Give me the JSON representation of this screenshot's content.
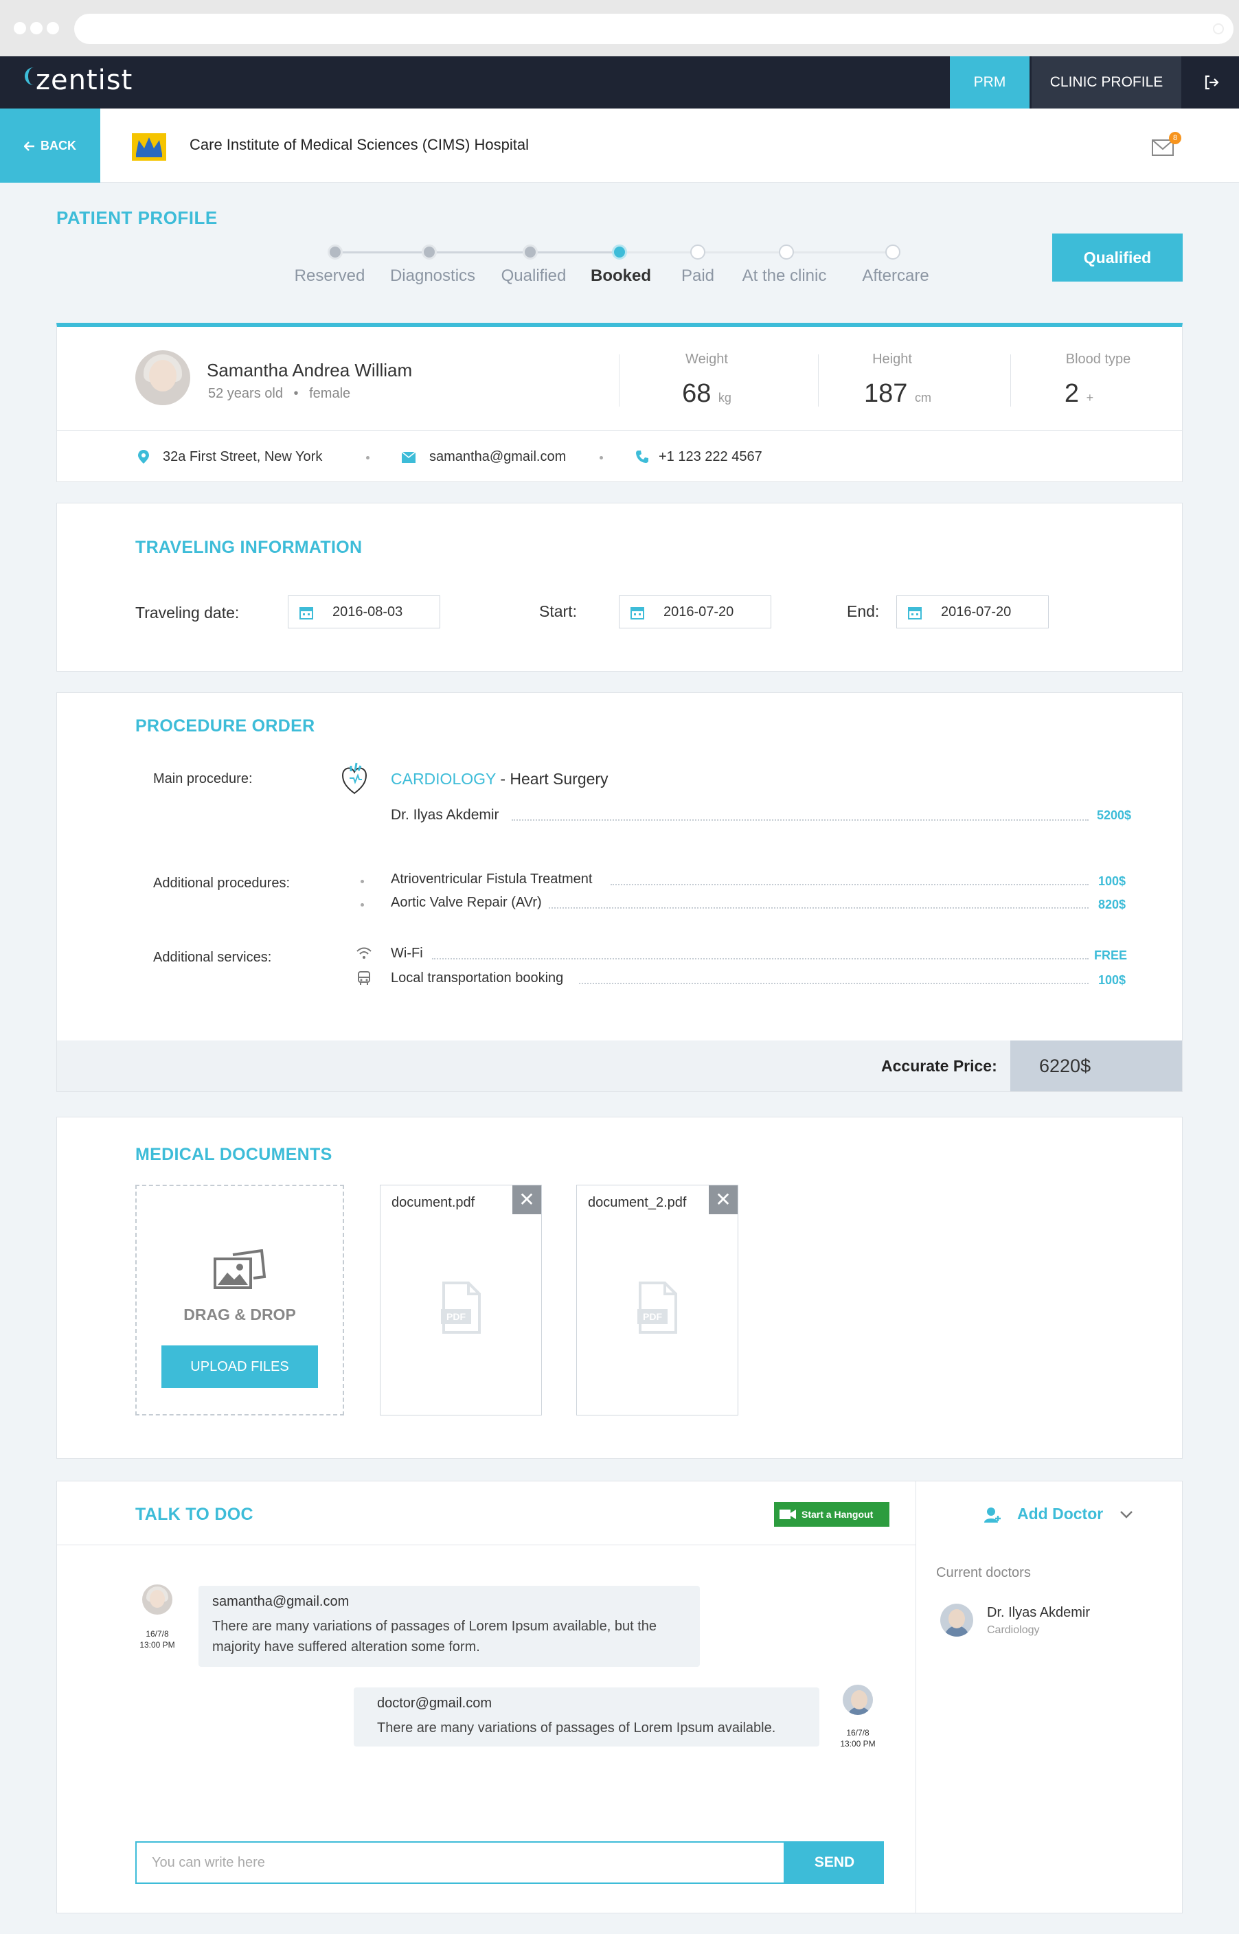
{
  "app": {
    "logo": "zentist"
  },
  "nav": {
    "prm": "PRM",
    "clinic_profile": "CLINIC PROFILE"
  },
  "header": {
    "back": "BACK",
    "clinic_name": "Care Institute of Medical Sciences (CIMS) Hospital",
    "mail_badge": "8"
  },
  "profile": {
    "title": "PATIENT PROFILE",
    "steps": [
      "Reserved",
      "Diagnostics",
      "Qualified",
      "Booked",
      "Paid",
      "At the clinic",
      "Aftercare"
    ],
    "current_step": "Booked",
    "status_button": "Qualified"
  },
  "patient": {
    "name": "Samantha Andrea William",
    "age": "52 years old",
    "gender": "female",
    "weight_label": "Weight",
    "weight_value": "68",
    "weight_unit": "kg",
    "height_label": "Height",
    "height_value": "187",
    "height_unit": "cm",
    "blood_label": "Blood type",
    "blood_value": "2",
    "blood_sign": "+",
    "address": "32a First Street, New York",
    "email": "samantha@gmail.com",
    "phone": "+1 123 222 4567"
  },
  "travel": {
    "title": "TRAVELING INFORMATION",
    "traveling_label": "Traveling date:",
    "traveling_value": "2016-08-03",
    "start_label": "Start:",
    "start_value": "2016-07-20",
    "end_label": "End:",
    "end_value": "2016-07-20"
  },
  "procedure": {
    "title": "PROCEDURE ORDER",
    "main_label": "Main procedure:",
    "main_dept": "CARDIOLOGY",
    "main_name": " - Heart Surgery",
    "main_doctor": "Dr. Ilyas Akdemir",
    "main_price": "5200$",
    "additional_label": "Additional procedures:",
    "additional": [
      {
        "name": "Atrioventricular Fistula Treatment",
        "price": "100$"
      },
      {
        "name": "Aortic Valve Repair (AVr)",
        "price": "820$"
      }
    ],
    "services_label": "Additional services:",
    "services": [
      {
        "name": "Wi-Fi",
        "price": "FREE"
      },
      {
        "name": "Local transportation booking",
        "price": "100$"
      }
    ],
    "accurate_label": "Accurate Price:",
    "accurate_value": "6220$"
  },
  "documents": {
    "title": "MEDICAL DOCUMENTS",
    "drop_text": "DRAG & DROP",
    "upload_button": "UPLOAD FILES",
    "files": [
      "document.pdf",
      "document_2.pdf"
    ],
    "pdf_label": "PDF"
  },
  "talk": {
    "title": "TALK TO DOC",
    "hangout_button": "Start a Hangout",
    "add_doctor": "Add Doctor",
    "current_doctors_label": "Current doctors",
    "current_doctor": {
      "name": "Dr. Ilyas Akdemir",
      "specialty": "Cardiology"
    },
    "messages": [
      {
        "from": "samantha@gmail.com",
        "text_line1": "There are many variations of passages of Lorem Ipsum available, but the",
        "text_line2": "majority have suffered alteration some form.",
        "date": "16/7/8",
        "time": "13:00 PM"
      },
      {
        "from": "doctor@gmail.com",
        "text_line1": "There are many variations of passages of Lorem Ipsum available.",
        "date": "16/7/8",
        "time": "13:00 PM"
      }
    ],
    "input_placeholder": "You can write here",
    "send_button": "SEND"
  },
  "colors": {
    "accent": "#3dbcd8",
    "nav_bg": "#1e2433",
    "hangout": "#2c9c3e",
    "badge": "#f7941d"
  }
}
